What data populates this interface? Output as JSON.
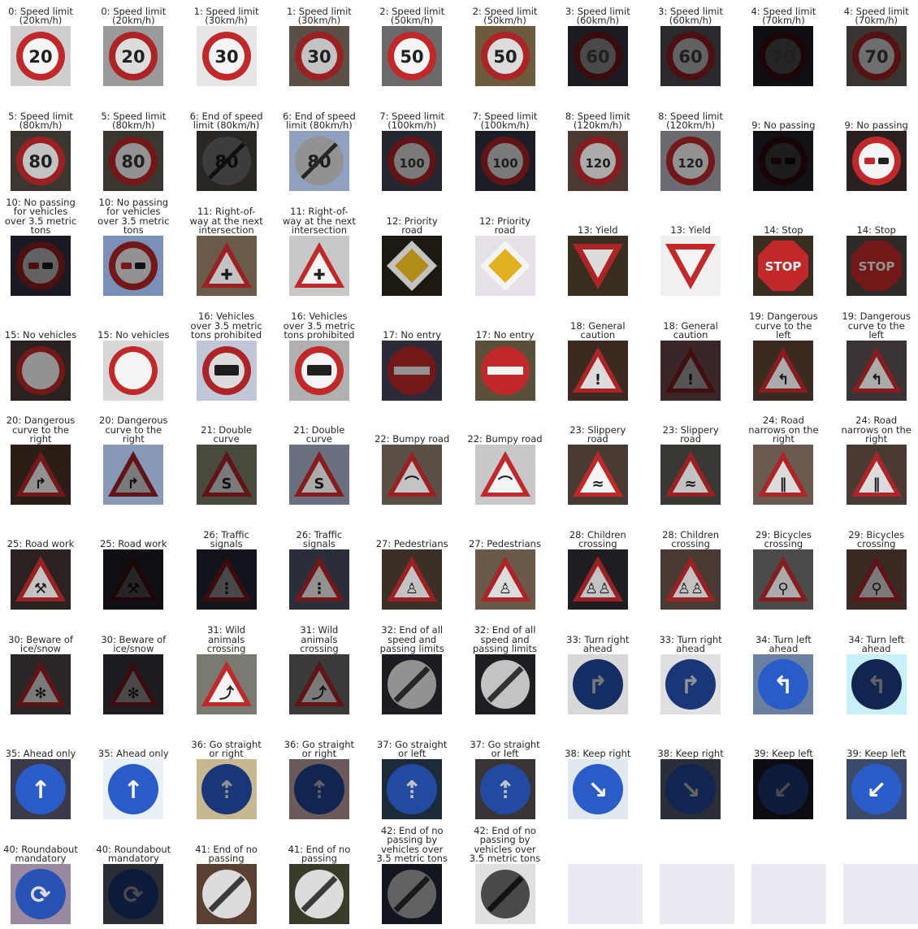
{
  "figure": {
    "panels": [
      {
        "label": "0: Speed limit\n(20km/h)",
        "sign": "speed",
        "text": "20",
        "bg": "#cfcfcf",
        "bright": 1.0
      },
      {
        "label": "0: Speed limit\n(20km/h)",
        "sign": "speed",
        "text": "20",
        "bg": "#9a9a9a",
        "bright": 0.9
      },
      {
        "label": "1: Speed limit\n(30km/h)",
        "sign": "speed",
        "text": "30",
        "bg": "#e6e6e6",
        "bright": 1.0
      },
      {
        "label": "1: Speed limit\n(30km/h)",
        "sign": "speed",
        "text": "30",
        "bg": "#5a5048",
        "bright": 0.8
      },
      {
        "label": "2: Speed limit\n(50km/h)",
        "sign": "speed",
        "text": "50",
        "bg": "#6a6a6a",
        "bright": 1.0
      },
      {
        "label": "2: Speed limit\n(50km/h)",
        "sign": "speed",
        "text": "50",
        "bg": "#6b5a3c",
        "bright": 0.9
      },
      {
        "label": "3: Speed limit\n(60km/h)",
        "sign": "speed",
        "text": "60",
        "bg": "#1a1c22",
        "bright": 0.3
      },
      {
        "label": "3: Speed limit\n(60km/h)",
        "sign": "speed",
        "text": "60",
        "bg": "#2a2a2e",
        "bright": 0.4
      },
      {
        "label": "4: Speed limit\n(70km/h)",
        "sign": "speed",
        "text": "70",
        "bg": "#0e1014",
        "bright": 0.15
      },
      {
        "label": "4: Speed limit\n(70km/h)",
        "sign": "speed",
        "text": "70",
        "bg": "#3a3430",
        "bright": 0.45
      },
      {
        "label": "5: Speed limit\n(80km/h)",
        "sign": "speed",
        "text": "80",
        "bg": "#3c3630",
        "bright": 0.8
      },
      {
        "label": "5: Speed limit\n(80km/h)",
        "sign": "speed",
        "text": "80",
        "bg": "#3a3630",
        "bright": 0.6
      },
      {
        "label": "6: End of speed\nlimit (80km/h)",
        "sign": "endspeed",
        "text": "80",
        "bg": "#2a2622",
        "bright": 0.25
      },
      {
        "label": "6: End of speed\nlimit (80km/h)",
        "sign": "endspeed",
        "text": "80",
        "bg": "#8fa0c0",
        "bright": 0.6
      },
      {
        "label": "7: Speed limit\n(100km/h)",
        "sign": "speed",
        "text": "100",
        "bg": "#242630",
        "bright": 0.5
      },
      {
        "label": "7: Speed limit\n(100km/h)",
        "sign": "speed",
        "text": "100",
        "bg": "#1c1e26",
        "bright": 0.5
      },
      {
        "label": "8: Speed limit\n(120km/h)",
        "sign": "speed",
        "text": "120",
        "bg": "#4a3a32",
        "bright": 0.7
      },
      {
        "label": "8: Speed limit\n(120km/h)",
        "sign": "speed",
        "text": "120",
        "bg": "#6a6a70",
        "bright": 0.6
      },
      {
        "label": "9: No passing",
        "sign": "nopass",
        "text": "",
        "bg": "#121216",
        "bright": 0.12
      },
      {
        "label": "9: No passing",
        "sign": "nopass",
        "text": "",
        "bg": "#2a2020",
        "bright": 1.0
      },
      {
        "label": "10: No passing\nfor vehicles\nover 3.5 metric\ntons",
        "sign": "nopasstruck",
        "text": "",
        "bg": "#1a1a22",
        "bright": 0.4
      },
      {
        "label": "10: No passing\nfor vehicles\nover 3.5 metric\ntons",
        "sign": "nopasstruck",
        "text": "",
        "bg": "#7a90b8",
        "bright": 0.6
      },
      {
        "label": "11: Right-of-\nway at the next\nintersection",
        "sign": "tri",
        "text": "✚",
        "bg": "#6a5a48",
        "bright": 0.8
      },
      {
        "label": "11: Right-of-\nway at the next\nintersection",
        "sign": "tri",
        "text": "✚",
        "bg": "#c8c8c8",
        "bright": 1.0
      },
      {
        "label": "12: Priority\nroad",
        "sign": "priority",
        "text": "",
        "bg": "#1e1812",
        "bright": 0.8
      },
      {
        "label": "12: Priority\nroad",
        "sign": "priority",
        "text": "",
        "bg": "#e8e0e8",
        "bright": 1.0
      },
      {
        "label": "13: Yield",
        "sign": "yield",
        "text": "",
        "bg": "#3a2e1e",
        "bright": 0.9
      },
      {
        "label": "13: Yield",
        "sign": "yield",
        "text": "",
        "bg": "#f0f0f0",
        "bright": 1.0
      },
      {
        "label": "14: Stop",
        "sign": "stop",
        "text": "STOP",
        "bg": "#3a2e22",
        "bright": 1.0
      },
      {
        "label": "14: Stop",
        "sign": "stop",
        "text": "STOP",
        "bg": "#2e2a28",
        "bright": 0.6
      },
      {
        "label": "15: No vehicles",
        "sign": "novehicle",
        "text": "",
        "bg": "#2a2220",
        "bright": 0.6
      },
      {
        "label": "15: No vehicles",
        "sign": "novehicle",
        "text": "",
        "bg": "#d8d8d8",
        "bright": 1.0
      },
      {
        "label": "16: Vehicles\nover 3.5 metric\ntons prohibited",
        "sign": "truck",
        "text": "",
        "bg": "#c0c8d8",
        "bright": 0.9
      },
      {
        "label": "16: Vehicles\nover 3.5 metric\ntons prohibited",
        "sign": "truck",
        "text": "",
        "bg": "#b0b0b0",
        "bright": 1.0
      },
      {
        "label": "17: No entry",
        "sign": "noentry",
        "text": "",
        "bg": "#2a2a38",
        "bright": 0.6
      },
      {
        "label": "17: No entry",
        "sign": "noentry",
        "text": "",
        "bg": "#5a5038",
        "bright": 1.0
      },
      {
        "label": "18: General\ncaution",
        "sign": "tri",
        "text": "!",
        "bg": "#3a2a20",
        "bright": 0.9
      },
      {
        "label": "18: General\ncaution",
        "sign": "tri",
        "text": "!",
        "bg": "#3a2626",
        "bright": 0.35
      },
      {
        "label": "19: Dangerous\ncurve to the\nleft",
        "sign": "tri",
        "text": "↰",
        "bg": "#3a2a20",
        "bright": 0.7
      },
      {
        "label": "19: Dangerous\ncurve to the\nleft",
        "sign": "tri",
        "text": "↰",
        "bg": "#3a3434",
        "bright": 0.7
      },
      {
        "label": "20: Dangerous\ncurve to the\nright",
        "sign": "tri",
        "text": "↱",
        "bg": "#2a1e16",
        "bright": 0.6
      },
      {
        "label": "20: Dangerous\ncurve to the\nright",
        "sign": "tri",
        "text": "↱",
        "bg": "#8898b8",
        "bright": 0.5
      },
      {
        "label": "21: Double\ncurve",
        "sign": "tri",
        "text": "S",
        "bg": "#4a4a3c",
        "bright": 0.5
      },
      {
        "label": "21: Double\ncurve",
        "sign": "tri",
        "text": "S",
        "bg": "#6a7080",
        "bright": 0.7
      },
      {
        "label": "22: Bumpy road",
        "sign": "tri",
        "text": "⌒",
        "bg": "#5a5048",
        "bright": 0.8
      },
      {
        "label": "22: Bumpy road",
        "sign": "tri",
        "text": "⌒",
        "bg": "#c8c8c8",
        "bright": 1.0
      },
      {
        "label": "23: Slippery\nroad",
        "sign": "tri",
        "text": "≈",
        "bg": "#4a3a34",
        "bright": 1.0
      },
      {
        "label": "23: Slippery\nroad",
        "sign": "tri",
        "text": "≈",
        "bg": "#3a3834",
        "bright": 0.8
      },
      {
        "label": "24: Road\nnarrows on the\nright",
        "sign": "tri",
        "text": "‖",
        "bg": "#6a5a50",
        "bright": 0.9
      },
      {
        "label": "24: Road\nnarrows on the\nright",
        "sign": "tri",
        "text": "‖",
        "bg": "#4a3a34",
        "bright": 0.9
      },
      {
        "label": "25: Road work",
        "sign": "tri",
        "text": "⚒",
        "bg": "#2a2220",
        "bright": 0.8
      },
      {
        "label": "25: Road work",
        "sign": "tri",
        "text": "⚒",
        "bg": "#101014",
        "bright": 0.15
      },
      {
        "label": "26: Traffic\nsignals",
        "sign": "tri",
        "text": "⋮",
        "bg": "#12141c",
        "bright": 0.3
      },
      {
        "label": "26: Traffic\nsignals",
        "sign": "tri",
        "text": "⋮",
        "bg": "#2a2e3a",
        "bright": 0.6
      },
      {
        "label": "27: Pedestrians",
        "sign": "tri",
        "text": "♙",
        "bg": "#3a3028",
        "bright": 0.8
      },
      {
        "label": "27: Pedestrians",
        "sign": "tri",
        "text": "♙",
        "bg": "#6a5848",
        "bright": 0.9
      },
      {
        "label": "28: Children\ncrossing",
        "sign": "tri",
        "text": "♙♙",
        "bg": "#1e1e22",
        "bright": 0.8
      },
      {
        "label": "28: Children\ncrossing",
        "sign": "tri",
        "text": "♙♙",
        "bg": "#4a3a34",
        "bright": 0.8
      },
      {
        "label": "29: Bicycles\ncrossing",
        "sign": "tri",
        "text": "⚲",
        "bg": "#4a4a48",
        "bright": 0.7
      },
      {
        "label": "29: Bicycles\ncrossing",
        "sign": "tri",
        "text": "⚲",
        "bg": "#3a2a24",
        "bright": 0.5
      },
      {
        "label": "30: Beware of\nice/snow",
        "sign": "tri",
        "text": "✻",
        "bg": "#2a2626",
        "bright": 0.5
      },
      {
        "label": "30: Beware of\nice/snow",
        "sign": "tri",
        "text": "✻",
        "bg": "#1c1c22",
        "bright": 0.3
      },
      {
        "label": "31: Wild\nanimals\ncrossing",
        "sign": "tri",
        "text": "⤴",
        "bg": "#7a7a70",
        "bright": 1.0
      },
      {
        "label": "31: Wild\nanimals\ncrossing",
        "sign": "tri",
        "text": "⤴",
        "bg": "#3a3a38",
        "bright": 0.5
      },
      {
        "label": "32: End of all\nspeed and\npassing limits",
        "sign": "endall",
        "text": "",
        "bg": "#1c1c22",
        "bright": 0.6
      },
      {
        "label": "32: End of all\nspeed and\npassing limits",
        "sign": "endall",
        "text": "",
        "bg": "#1e1e22",
        "bright": 0.8
      },
      {
        "label": "33: Turn right\nahead",
        "sign": "blue",
        "text": "↱",
        "bg": "#d8d8d8",
        "bright": 0.5
      },
      {
        "label": "33: Turn right\nahead",
        "sign": "blue",
        "text": "↱",
        "bg": "#e0e0e0",
        "bright": 0.6
      },
      {
        "label": "34: Turn left\nahead",
        "sign": "blue",
        "text": "↰",
        "bg": "#6a80a0",
        "bright": 1.0
      },
      {
        "label": "34: Turn left\nahead",
        "sign": "blue",
        "text": "↰",
        "bg": "#c8f0f8",
        "bright": 0.4
      },
      {
        "label": "35: Ahead only",
        "sign": "blue",
        "text": "↑",
        "bg": "#3a3a48",
        "bright": 1.0
      },
      {
        "label": "35: Ahead only",
        "sign": "blue",
        "text": "↑",
        "bg": "#e8f0f8",
        "bright": 1.0
      },
      {
        "label": "36: Go straight\nor right",
        "sign": "blue",
        "text": "⇡",
        "bg": "#c8b890",
        "bright": 0.6
      },
      {
        "label": "36: Go straight\nor right",
        "sign": "blue",
        "text": "⇡",
        "bg": "#6a5a5a",
        "bright": 0.4
      },
      {
        "label": "37: Go straight\nor left",
        "sign": "blue",
        "text": "⇡",
        "bg": "#1c2a3a",
        "bright": 0.8
      },
      {
        "label": "37: Go straight\nor left",
        "sign": "blue",
        "text": "⇡",
        "bg": "#3a3434",
        "bright": 0.8
      },
      {
        "label": "38: Keep right",
        "sign": "blue",
        "text": "↘",
        "bg": "#e0e8f0",
        "bright": 1.0
      },
      {
        "label": "38: Keep right",
        "sign": "blue",
        "text": "↘",
        "bg": "#2a2e38",
        "bright": 0.4
      },
      {
        "label": "39: Keep left",
        "sign": "blue",
        "text": "↙",
        "bg": "#0c0c12",
        "bright": 0.3
      },
      {
        "label": "39: Keep left",
        "sign": "blue",
        "text": "↙",
        "bg": "#3a4a6a",
        "bright": 1.0
      },
      {
        "label": "40: Roundabout\nmandatory",
        "sign": "blue",
        "text": "⟳",
        "bg": "#9a8aa0",
        "bright": 0.9
      },
      {
        "label": "40: Roundabout\nmandatory",
        "sign": "blue",
        "text": "⟳",
        "bg": "#2a2e34",
        "bright": 0.3
      },
      {
        "label": "41: End of no\npassing",
        "sign": "endall",
        "text": "",
        "bg": "#5a4030",
        "bright": 0.9
      },
      {
        "label": "41: End of no\npassing",
        "sign": "endall",
        "text": "",
        "bg": "#3a3a2a",
        "bright": 0.9
      },
      {
        "label": "42: End of no\npassing by\nvehicles over\n3.5 metric tons",
        "sign": "endall",
        "text": "",
        "bg": "#12161e",
        "bright": 0.4
      },
      {
        "label": "42: End of no\npassing by\nvehicles over\n3.5 metric tons",
        "sign": "endall",
        "text": "",
        "bg": "#e0e0e0",
        "bright": 0.3
      },
      {
        "label": "",
        "sign": "blank",
        "text": "",
        "bg": "#eaeaf2",
        "bright": 1.0
      },
      {
        "label": "",
        "sign": "blank",
        "text": "",
        "bg": "#eaeaf2",
        "bright": 1.0
      },
      {
        "label": "",
        "sign": "blank",
        "text": "",
        "bg": "#eaeaf2",
        "bright": 1.0
      },
      {
        "label": "",
        "sign": "blank",
        "text": "",
        "bg": "#eaeaf2",
        "bright": 1.0
      }
    ]
  },
  "colors": {
    "red": "#c0282a",
    "blue": "#2a5cc8",
    "white": "#f4f4f4",
    "text": "#262626",
    "blank": "#eaeaf2"
  }
}
